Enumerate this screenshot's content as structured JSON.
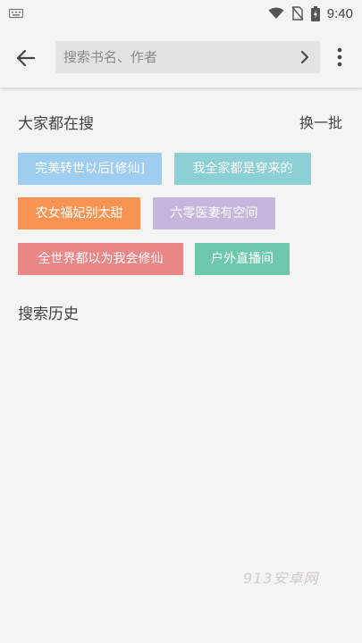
{
  "status_bar": {
    "time": "9:40",
    "icons": [
      "keyboard-icon",
      "wifi-icon",
      "no-sim-icon",
      "battery-icon"
    ]
  },
  "search": {
    "placeholder": "搜索书名、作者",
    "back_icon": "arrow-left-icon",
    "go_icon": "chevron-right-icon",
    "more_icon": "more-vertical-icon"
  },
  "hot": {
    "title": "大家都在搜",
    "refresh_label": "换一批",
    "tags": [
      {
        "label": "完美转世以后[修仙]",
        "color": "#9fcdf0"
      },
      {
        "label": "我全家都是穿来的",
        "color": "#8ccfd4"
      },
      {
        "label": "农女福妃别太甜",
        "color": "#f79454"
      },
      {
        "label": "六零医妻有空间",
        "color": "#c6b5dc"
      },
      {
        "label": "全世界都以为我会修仙",
        "color": "#e98686"
      },
      {
        "label": "户外直播间",
        "color": "#6cc9ac"
      }
    ]
  },
  "history": {
    "title": "搜索历史"
  },
  "watermark": "913安卓网"
}
